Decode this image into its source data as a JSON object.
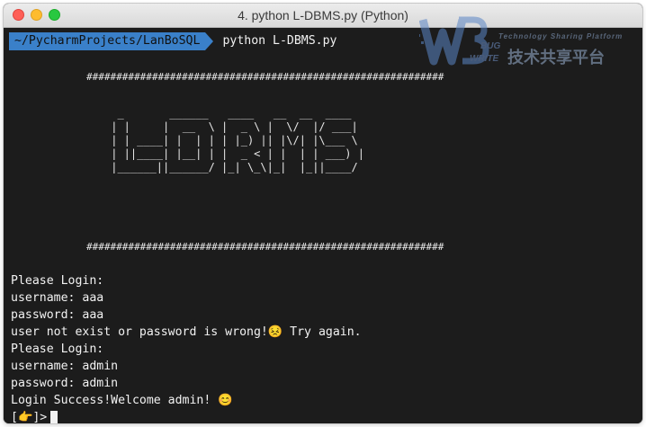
{
  "window": {
    "title": "4. python L-DBMS.py (Python)"
  },
  "watermark": {
    "tagline": "Technology Sharing Platform",
    "cn_name": "技术共享平台",
    "logo_bug": "BUG",
    "logo_write": "WRITE"
  },
  "prompt": {
    "path": "~/PycharmProjects/LanBoSQL",
    "command": "python L-DBMS.py"
  },
  "banner": {
    "hashes": "############################################################",
    "art": "  _       ______   ____   __  __  ____ \n | |     |  __  \\ |  _ \\ |  \\/  |/ ___|\n | | ____| |  | | | |_) || |\\/| |\\___ \\\n | ||____| |__| | |  _ < | |  | | ___) |\n |______||______/ |_| \\_\\|_|  |_||____/"
  },
  "output": {
    "lines": [
      "Please Login:",
      "username: aaa",
      "password: aaa",
      "user not exist or password is wrong!😣 Try again.",
      "Please Login:",
      "username: admin",
      "password: admin",
      "Login Success!Welcome admin! 😊"
    ],
    "prompt2": "[👉]>"
  },
  "colors": {
    "path_bg": "#3a80c9",
    "terminal_bg": "#1c1c1c",
    "text": "#f2f2f2"
  }
}
